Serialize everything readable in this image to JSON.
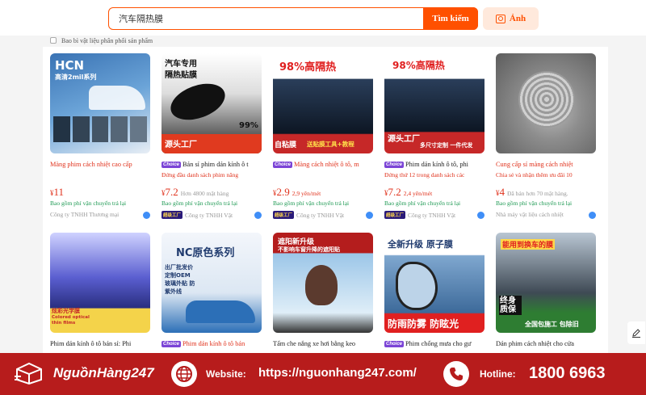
{
  "search": {
    "query": "汽车隔热膜",
    "button_label": "Tìm kiếm",
    "image_button_label": "Ảnh"
  },
  "filter": {
    "label": "Bao bì vật liệu phân phối sản phẩm"
  },
  "products": [
    {
      "title": "Màng phim cách nhiệt cao cấp",
      "choice": false,
      "title_red": true,
      "rank": "",
      "price": "11",
      "price_note": "",
      "shipping": "Bao gồm phí vận chuyển trả lại",
      "seller_tag": "",
      "seller": "Công ty TNHH Thương mại",
      "image": {
        "caption1": "HCN",
        "caption2": "高清2mil系列",
        "bg": "#3a73b4"
      }
    },
    {
      "title": "Bán sỉ phim dán kính ô t",
      "choice": true,
      "title_red": false,
      "rank": "Đứng đầu danh sách phim năng",
      "price": "7.2",
      "price_note": "Hơn 4800 mặt hàng",
      "shipping": "Bao gồm phí vận chuyển trả lại",
      "seller_tag": "超级工厂",
      "seller": "Công ty TNHH Vật",
      "image": {
        "caption1": "汽车专用",
        "caption2": "隔热贴膜",
        "caption3": "源头工厂",
        "caption4": "99%",
        "bg": "#2b2b2b"
      }
    },
    {
      "title": "Màng cách nhiệt ô tô, m",
      "choice": true,
      "title_red": true,
      "rank": "",
      "price": "2.9",
      "price_note": "2,9 yên/mét",
      "price_note_red": true,
      "shipping": "Bao gồm phí vận chuyển trả lại",
      "seller_tag": "超级工厂",
      "seller": "Công ty TNHH Vật",
      "image": {
        "caption1": "98%高隔热",
        "caption3": "自粘膜",
        "caption4": "送贴膜工具+教程",
        "bg": "#d32f2f"
      }
    },
    {
      "title": "Phim dán kính ô tô, phi",
      "choice": true,
      "title_red": false,
      "rank": "Đứng thứ 12 trong danh sách các",
      "price": "7.2",
      "price_note": "2,4 yên/mét",
      "price_note_red": true,
      "shipping": "Bao gồm phí vận chuyển trả lại",
      "seller_tag": "超级工厂",
      "seller": "Công ty TNHH Vật",
      "image": {
        "caption1": "98%高隔热",
        "caption3": "源头工厂",
        "caption4": "多尺寸定制 一件代发",
        "bg": "#d32f2f"
      }
    },
    {
      "title": "Cung cấp sỉ màng cách nhiệt",
      "choice": false,
      "title_red": true,
      "rank": "Chia sẻ và nhận thêm ưu đãi 10",
      "price": "4",
      "price_note": "Đã bán hơn 70 mặt hàng.",
      "shipping": "Bao gồm phí vận chuyển trả lại",
      "seller_tag": "",
      "seller": "Nhà máy vật liệu cách nhiệt",
      "image": {
        "bg": "#8d8d8d"
      }
    },
    {
      "title": "Phim dán kính ô tô bán sỉ: Phi",
      "choice": false,
      "title_red": false,
      "image": {
        "caption1": "炫彩光学膜",
        "caption2": "Colored optical thin films",
        "bg": "#2a2f80"
      }
    },
    {
      "title": "Phim dán kính ô tô bán",
      "choice": true,
      "title_red": true,
      "image": {
        "caption1": "NC原色系列",
        "caption2": "出厂批发价 定制OEM 玻璃外贴 防紫外线",
        "bg": "#2c6fb7"
      }
    },
    {
      "title": "Tấm che nắng xe hơi bằng keo",
      "choice": false,
      "title_red": false,
      "image": {
        "caption1": "遮阳新升级",
        "caption2": "不影响车窗升降的遮阳贴",
        "bg": "#b41d1d"
      }
    },
    {
      "title": "Phim chống mưa cho gư",
      "choice": true,
      "title_red": false,
      "image": {
        "caption1": "全新升级 原子膜",
        "caption3": "防雨防雾 防眩光",
        "bg": "#1f5fb3"
      }
    },
    {
      "title": "Dán phim cách nhiệt cho cửa",
      "choice": false,
      "title_red": false,
      "image": {
        "caption1": "能用到换车的膜",
        "caption3": "终身质保",
        "caption4": "全国包施工 包除旧",
        "bg": "#3f4a55"
      }
    }
  ],
  "footer": {
    "brand": "NguồnHàng247",
    "website_label": "Website:",
    "website": "https://nguonhang247.com/",
    "hotline_label": "Hotline:",
    "hotline": "1800 6963",
    "bg": "#b71c1c"
  },
  "colors": {
    "accent": "#ff5000",
    "price_red": "#e0321c",
    "shipping_green": "#1f9a54",
    "choice_purple": "#7b44d6"
  }
}
